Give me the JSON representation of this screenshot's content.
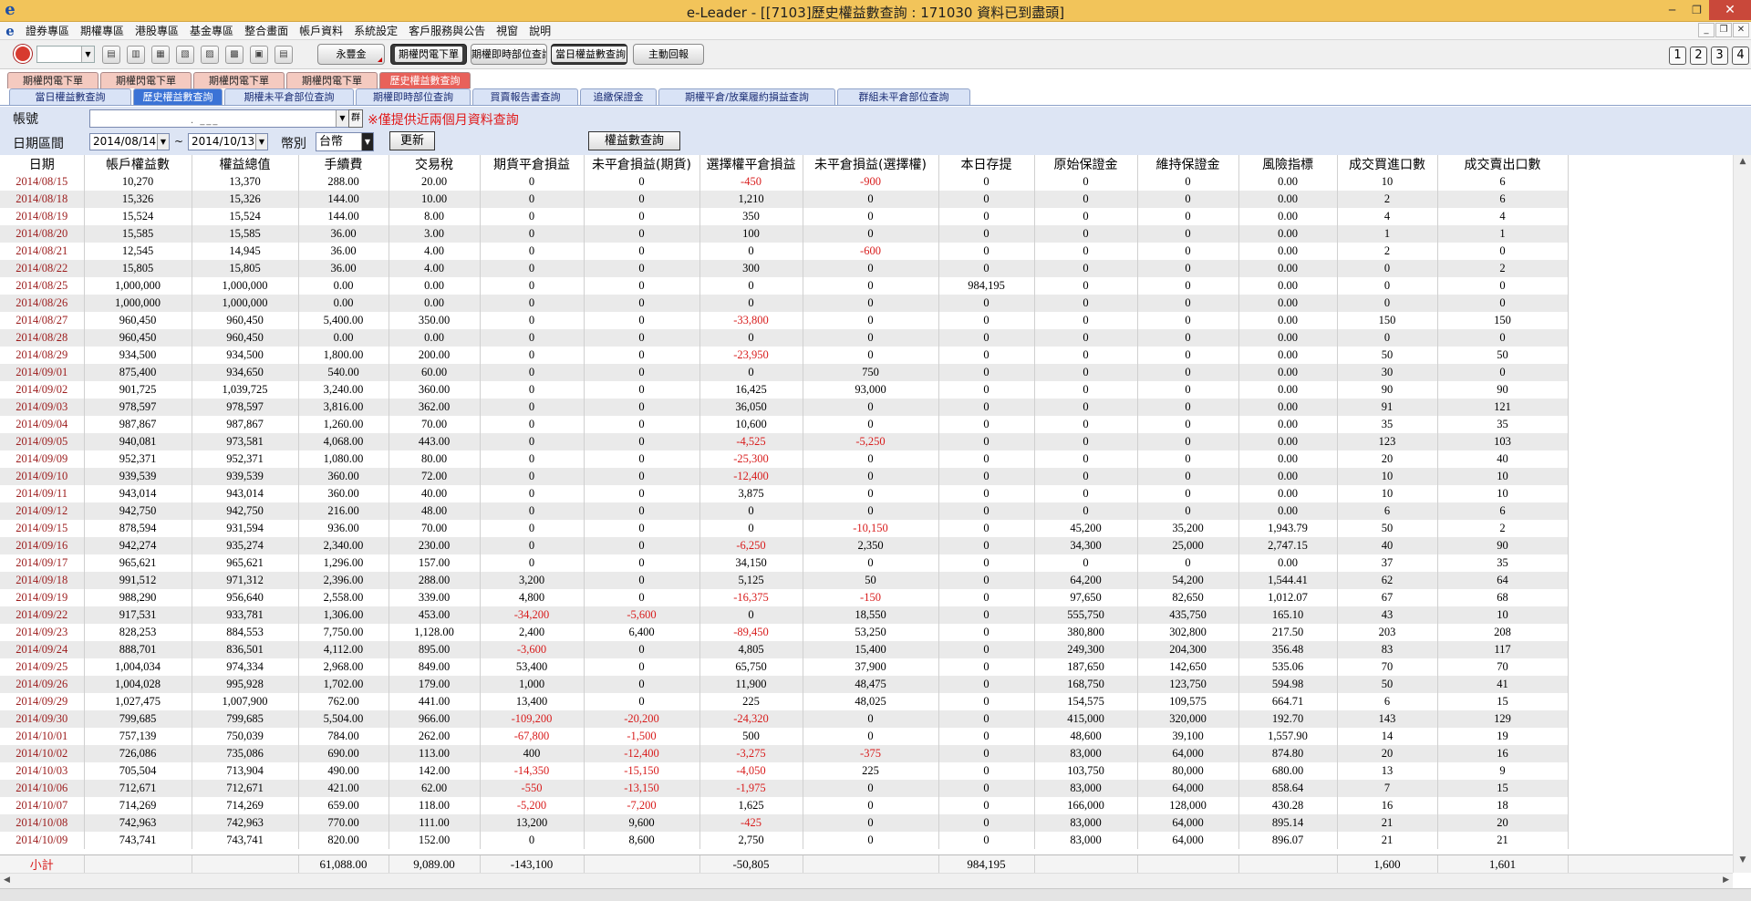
{
  "window": {
    "title": "e-Leader - [[7103]歷史權益數查詢 : 171030 資料已到盡頭]",
    "logo": "e",
    "controls": [
      "─",
      "❐",
      "✕"
    ]
  },
  "menu": {
    "logo": "e",
    "items": [
      "證券專區",
      "期權專區",
      "港股專區",
      "基金專區",
      "整合畫面",
      "帳戶資料",
      "系統設定",
      "客戶服務與公告",
      "視窗",
      "說明"
    ],
    "mdi_controls": [
      "_",
      "❐",
      "✕"
    ]
  },
  "toolbar": {
    "buttons": [
      "永豐金",
      "期權閃電下單",
      "期權即時部位查詢",
      "當日權益數查詢",
      "主動回報"
    ],
    "pages": [
      "1",
      "2",
      "3",
      "4"
    ],
    "icons": [
      "record-icon",
      "doc-icon-1",
      "doc-icon-2",
      "doc-icon-3",
      "doc-icon-4",
      "doc-icon-5",
      "doc-icon-6",
      "doc-icon-7",
      "doc-icon-8"
    ]
  },
  "tabs_top": [
    {
      "label": "期權閃電下單",
      "active": false
    },
    {
      "label": "期權閃電下單",
      "active": false
    },
    {
      "label": "期權閃電下單",
      "active": false
    },
    {
      "label": "期權閃電下單",
      "active": false
    },
    {
      "label": "歷史權益數查詢",
      "active": true
    }
  ],
  "tabs_sub": [
    {
      "label": "當日權益數查詢",
      "active": false
    },
    {
      "label": "歷史權益數查詢",
      "active": true
    },
    {
      "label": "期權未平倉部位查詢",
      "active": false
    },
    {
      "label": "期權即時部位查詢",
      "active": false
    },
    {
      "label": "買賣報告書查詢",
      "active": false
    },
    {
      "label": "追繳保證金",
      "active": false
    },
    {
      "label": "期權平倉/放棄履約損益查詢",
      "active": false
    },
    {
      "label": "群組未平倉部位查詢",
      "active": false
    }
  ],
  "form": {
    "account_label": "帳號",
    "account_mask": ". ___",
    "group_button": "群",
    "warning": "※僅提供近兩個月資料查詢",
    "date_label": "日期區間",
    "date_from": "2014/08/14",
    "date_sep": "~",
    "date_to": "2014/10/13",
    "currency_label": "幣別",
    "currency": "台幣",
    "refresh_button": "更新",
    "query_button": "權益數查詢"
  },
  "colors": {
    "negative": "#d81c1c",
    "date": "#9b1b1b",
    "titlebar": "#f2c45a",
    "active_tab": "#e8615a",
    "active_subtab": "#3b73d6"
  },
  "table": {
    "headers": [
      "日期",
      "帳戶權益數",
      "權益總值",
      "手續費",
      "交易稅",
      "期貨平倉損益",
      "未平倉損益(期貨)",
      "選擇權平倉損益",
      "未平倉損益(選擇權)",
      "本日存提",
      "原始保證金",
      "維持保證金",
      "風險指標",
      "成交買進口數",
      "成交賣出口數"
    ],
    "rows": [
      [
        "2014/08/15",
        "10,270",
        "13,370",
        "288.00",
        "20.00",
        "0",
        "0",
        "-450",
        "-900",
        "0",
        "0",
        "0",
        "0.00",
        "10",
        "6"
      ],
      [
        "2014/08/18",
        "15,326",
        "15,326",
        "144.00",
        "10.00",
        "0",
        "0",
        "1,210",
        "0",
        "0",
        "0",
        "0",
        "0.00",
        "2",
        "6"
      ],
      [
        "2014/08/19",
        "15,524",
        "15,524",
        "144.00",
        "8.00",
        "0",
        "0",
        "350",
        "0",
        "0",
        "0",
        "0",
        "0.00",
        "4",
        "4"
      ],
      [
        "2014/08/20",
        "15,585",
        "15,585",
        "36.00",
        "3.00",
        "0",
        "0",
        "100",
        "0",
        "0",
        "0",
        "0",
        "0.00",
        "1",
        "1"
      ],
      [
        "2014/08/21",
        "12,545",
        "14,945",
        "36.00",
        "4.00",
        "0",
        "0",
        "0",
        "-600",
        "0",
        "0",
        "0",
        "0.00",
        "2",
        "0"
      ],
      [
        "2014/08/22",
        "15,805",
        "15,805",
        "36.00",
        "4.00",
        "0",
        "0",
        "300",
        "0",
        "0",
        "0",
        "0",
        "0.00",
        "0",
        "2"
      ],
      [
        "2014/08/25",
        "1,000,000",
        "1,000,000",
        "0.00",
        "0.00",
        "0",
        "0",
        "0",
        "0",
        "984,195",
        "0",
        "0",
        "0.00",
        "0",
        "0"
      ],
      [
        "2014/08/26",
        "1,000,000",
        "1,000,000",
        "0.00",
        "0.00",
        "0",
        "0",
        "0",
        "0",
        "0",
        "0",
        "0",
        "0.00",
        "0",
        "0"
      ],
      [
        "2014/08/27",
        "960,450",
        "960,450",
        "5,400.00",
        "350.00",
        "0",
        "0",
        "-33,800",
        "0",
        "0",
        "0",
        "0",
        "0.00",
        "150",
        "150"
      ],
      [
        "2014/08/28",
        "960,450",
        "960,450",
        "0.00",
        "0.00",
        "0",
        "0",
        "0",
        "0",
        "0",
        "0",
        "0",
        "0.00",
        "0",
        "0"
      ],
      [
        "2014/08/29",
        "934,500",
        "934,500",
        "1,800.00",
        "200.00",
        "0",
        "0",
        "-23,950",
        "0",
        "0",
        "0",
        "0",
        "0.00",
        "50",
        "50"
      ],
      [
        "2014/09/01",
        "875,400",
        "934,650",
        "540.00",
        "60.00",
        "0",
        "0",
        "0",
        "750",
        "0",
        "0",
        "0",
        "0.00",
        "30",
        "0"
      ],
      [
        "2014/09/02",
        "901,725",
        "1,039,725",
        "3,240.00",
        "360.00",
        "0",
        "0",
        "16,425",
        "93,000",
        "0",
        "0",
        "0",
        "0.00",
        "90",
        "90"
      ],
      [
        "2014/09/03",
        "978,597",
        "978,597",
        "3,816.00",
        "362.00",
        "0",
        "0",
        "36,050",
        "0",
        "0",
        "0",
        "0",
        "0.00",
        "91",
        "121"
      ],
      [
        "2014/09/04",
        "987,867",
        "987,867",
        "1,260.00",
        "70.00",
        "0",
        "0",
        "10,600",
        "0",
        "0",
        "0",
        "0",
        "0.00",
        "35",
        "35"
      ],
      [
        "2014/09/05",
        "940,081",
        "973,581",
        "4,068.00",
        "443.00",
        "0",
        "0",
        "-4,525",
        "-5,250",
        "0",
        "0",
        "0",
        "0.00",
        "123",
        "103"
      ],
      [
        "2014/09/09",
        "952,371",
        "952,371",
        "1,080.00",
        "80.00",
        "0",
        "0",
        "-25,300",
        "0",
        "0",
        "0",
        "0",
        "0.00",
        "20",
        "40"
      ],
      [
        "2014/09/10",
        "939,539",
        "939,539",
        "360.00",
        "72.00",
        "0",
        "0",
        "-12,400",
        "0",
        "0",
        "0",
        "0",
        "0.00",
        "10",
        "10"
      ],
      [
        "2014/09/11",
        "943,014",
        "943,014",
        "360.00",
        "40.00",
        "0",
        "0",
        "3,875",
        "0",
        "0",
        "0",
        "0",
        "0.00",
        "10",
        "10"
      ],
      [
        "2014/09/12",
        "942,750",
        "942,750",
        "216.00",
        "48.00",
        "0",
        "0",
        "0",
        "0",
        "0",
        "0",
        "0",
        "0.00",
        "6",
        "6"
      ],
      [
        "2014/09/15",
        "878,594",
        "931,594",
        "936.00",
        "70.00",
        "0",
        "0",
        "0",
        "-10,150",
        "0",
        "45,200",
        "35,200",
        "1,943.79",
        "50",
        "2"
      ],
      [
        "2014/09/16",
        "942,274",
        "935,274",
        "2,340.00",
        "230.00",
        "0",
        "0",
        "-6,250",
        "2,350",
        "0",
        "34,300",
        "25,000",
        "2,747.15",
        "40",
        "90"
      ],
      [
        "2014/09/17",
        "965,621",
        "965,621",
        "1,296.00",
        "157.00",
        "0",
        "0",
        "34,150",
        "0",
        "0",
        "0",
        "0",
        "0.00",
        "37",
        "35"
      ],
      [
        "2014/09/18",
        "991,512",
        "971,312",
        "2,396.00",
        "288.00",
        "3,200",
        "0",
        "5,125",
        "50",
        "0",
        "64,200",
        "54,200",
        "1,544.41",
        "62",
        "64"
      ],
      [
        "2014/09/19",
        "988,290",
        "956,640",
        "2,558.00",
        "339.00",
        "4,800",
        "0",
        "-16,375",
        "-150",
        "0",
        "97,650",
        "82,650",
        "1,012.07",
        "67",
        "68"
      ],
      [
        "2014/09/22",
        "917,531",
        "933,781",
        "1,306.00",
        "453.00",
        "-34,200",
        "-5,600",
        "0",
        "18,550",
        "0",
        "555,750",
        "435,750",
        "165.10",
        "43",
        "10"
      ],
      [
        "2014/09/23",
        "828,253",
        "884,553",
        "7,750.00",
        "1,128.00",
        "2,400",
        "6,400",
        "-89,450",
        "53,250",
        "0",
        "380,800",
        "302,800",
        "217.50",
        "203",
        "208"
      ],
      [
        "2014/09/24",
        "888,701",
        "836,501",
        "4,112.00",
        "895.00",
        "-3,600",
        "0",
        "4,805",
        "15,400",
        "0",
        "249,300",
        "204,300",
        "356.48",
        "83",
        "117"
      ],
      [
        "2014/09/25",
        "1,004,034",
        "974,334",
        "2,968.00",
        "849.00",
        "53,400",
        "0",
        "65,750",
        "37,900",
        "0",
        "187,650",
        "142,650",
        "535.06",
        "70",
        "70"
      ],
      [
        "2014/09/26",
        "1,004,028",
        "995,928",
        "1,702.00",
        "179.00",
        "1,000",
        "0",
        "11,900",
        "48,475",
        "0",
        "168,750",
        "123,750",
        "594.98",
        "50",
        "41"
      ],
      [
        "2014/09/29",
        "1,027,475",
        "1,007,900",
        "762.00",
        "441.00",
        "13,400",
        "0",
        "225",
        "48,025",
        "0",
        "154,575",
        "109,575",
        "664.71",
        "6",
        "15"
      ],
      [
        "2014/09/30",
        "799,685",
        "799,685",
        "5,504.00",
        "966.00",
        "-109,200",
        "-20,200",
        "-24,320",
        "0",
        "0",
        "415,000",
        "320,000",
        "192.70",
        "143",
        "129"
      ],
      [
        "2014/10/01",
        "757,139",
        "750,039",
        "784.00",
        "262.00",
        "-67,800",
        "-1,500",
        "500",
        "0",
        "0",
        "48,600",
        "39,100",
        "1,557.90",
        "14",
        "19"
      ],
      [
        "2014/10/02",
        "726,086",
        "735,086",
        "690.00",
        "113.00",
        "400",
        "-12,400",
        "-3,275",
        "-375",
        "0",
        "83,000",
        "64,000",
        "874.80",
        "20",
        "16"
      ],
      [
        "2014/10/03",
        "705,504",
        "713,904",
        "490.00",
        "142.00",
        "-14,350",
        "-15,150",
        "-4,050",
        "225",
        "0",
        "103,750",
        "80,000",
        "680.00",
        "13",
        "9"
      ],
      [
        "2014/10/06",
        "712,671",
        "712,671",
        "421.00",
        "62.00",
        "-550",
        "-13,150",
        "-1,975",
        "0",
        "0",
        "83,000",
        "64,000",
        "858.64",
        "7",
        "15"
      ],
      [
        "2014/10/07",
        "714,269",
        "714,269",
        "659.00",
        "118.00",
        "-5,200",
        "-7,200",
        "1,625",
        "0",
        "0",
        "166,000",
        "128,000",
        "430.28",
        "16",
        "18"
      ],
      [
        "2014/10/08",
        "742,963",
        "742,963",
        "770.00",
        "111.00",
        "13,200",
        "9,600",
        "-425",
        "0",
        "0",
        "83,000",
        "64,000",
        "895.14",
        "21",
        "20"
      ],
      [
        "2014/10/09",
        "743,741",
        "743,741",
        "820.00",
        "152.00",
        "0",
        "8,600",
        "2,750",
        "0",
        "0",
        "83,000",
        "64,000",
        "896.07",
        "21",
        "21"
      ]
    ],
    "summary": [
      "小計",
      "",
      "",
      "61,088.00",
      "9,089.00",
      "-143,100",
      "",
      "-50,805",
      "",
      "984,195",
      "",
      "",
      "",
      "1,600",
      "1,601"
    ]
  }
}
